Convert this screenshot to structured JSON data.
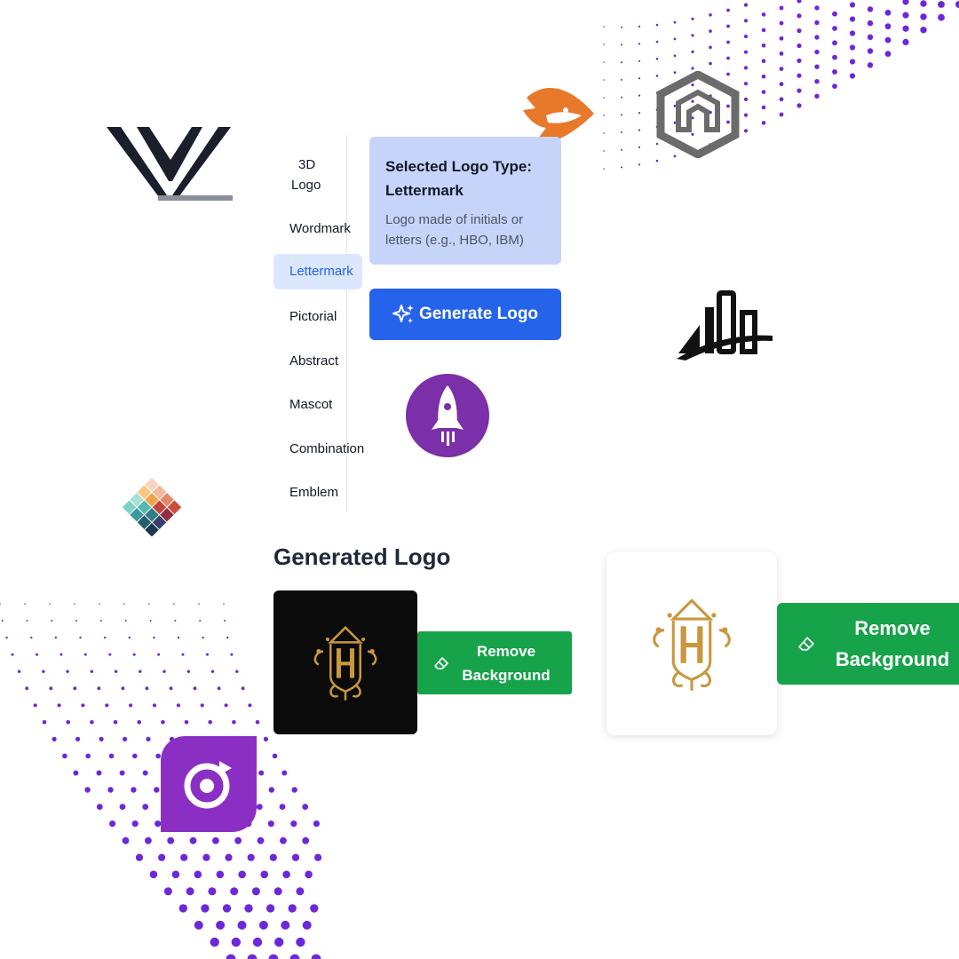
{
  "logo_types": {
    "items": [
      "3D\nLogo",
      "Wordmark",
      "Lettermark",
      "Pictorial",
      "Abstract",
      "Mascot",
      "Combination",
      "Emblem"
    ],
    "selected": "Lettermark"
  },
  "info": {
    "title": "Selected Logo Type: Lettermark",
    "description": "Logo made of initials or letters (e.g., HBO, IBM)"
  },
  "generate_button": {
    "label": "Generate Logo",
    "icon": "sparkles-icon"
  },
  "generated": {
    "heading": "Generated Logo",
    "remove_bg_label": "Remove Background",
    "remove_bg_icon": "eraser-icon"
  },
  "colors": {
    "accent_blue": "#2563eb",
    "info_bg": "#c7d4fa",
    "selected_bg": "#dbe7fd",
    "green": "#16a34a",
    "dots_purple": "#6d28d9"
  }
}
